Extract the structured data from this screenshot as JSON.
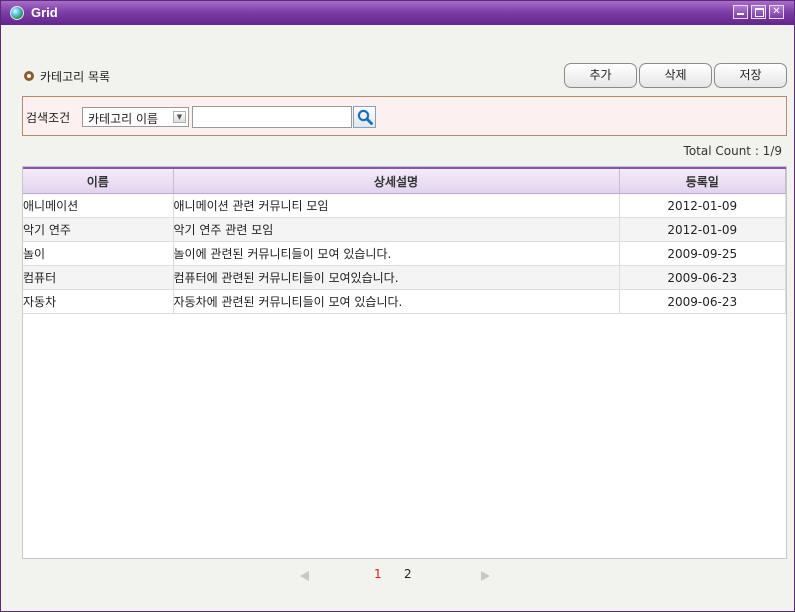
{
  "window": {
    "title": "Grid"
  },
  "section": {
    "title": "카테고리 목록"
  },
  "toolbar": {
    "add_label": "추가",
    "delete_label": "삭제",
    "save_label": "저장"
  },
  "search": {
    "label": "검색조건",
    "select_value": "카테고리 이름",
    "input_value": "",
    "input_placeholder": ""
  },
  "total_count": "Total Count : 1/9",
  "grid": {
    "columns": [
      "이름",
      "상세설명",
      "등록일"
    ],
    "rows": [
      [
        "애니메이션",
        "애니메이션 관련 커뮤니티 모임",
        "2012-01-09"
      ],
      [
        "악기 연주",
        "악기 연주 관련 모임",
        "2012-01-09"
      ],
      [
        "놀이",
        "놀이에 관련된 커뮤니티들이 모여 있습니다.",
        "2009-09-25"
      ],
      [
        "컴퓨터",
        "컴퓨터에 관련된 커뮤니티들이 모여있습니다.",
        "2009-06-23"
      ],
      [
        "자동차",
        "자동차에 관련된 커뮤니티들이 모여 있습니다.",
        "2009-06-23"
      ]
    ]
  },
  "pager": {
    "pages": [
      "1",
      "2"
    ],
    "current": "1"
  },
  "colors": {
    "titlebar": "#7d3ea6",
    "current_page": "#dd2222",
    "header_accent": "#8a55b0"
  },
  "icons": {
    "app": "globe-icon",
    "search": "magnifier-icon"
  }
}
